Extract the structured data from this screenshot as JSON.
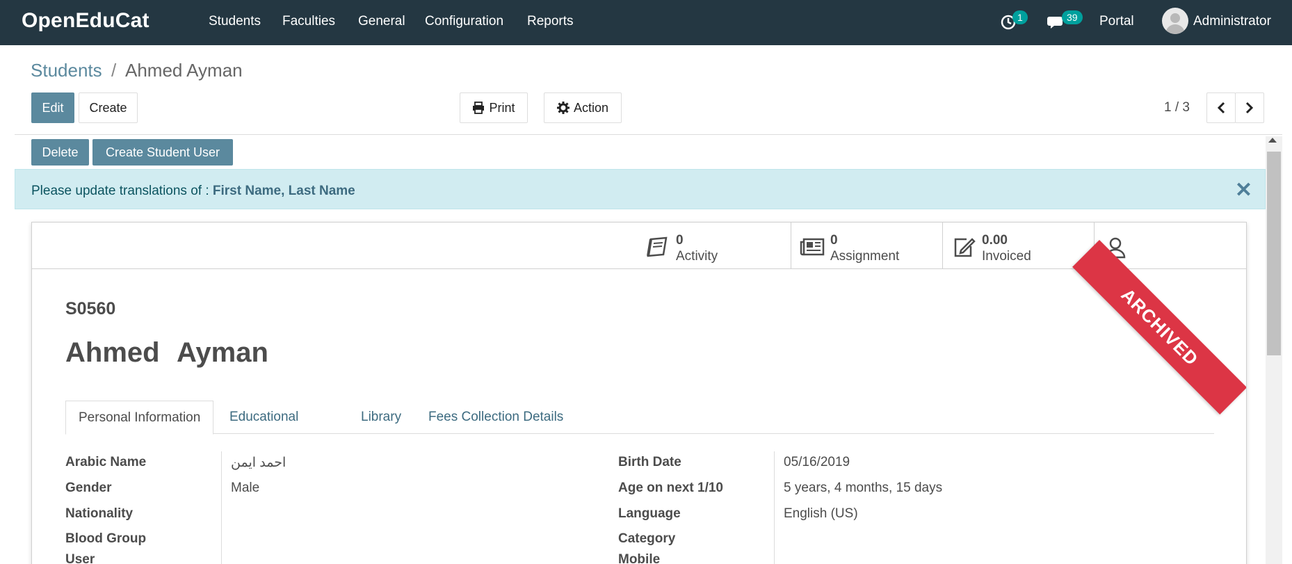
{
  "navbar": {
    "brand": "OpenEduCat",
    "menu": [
      "Students",
      "Faculties",
      "General",
      "Configuration",
      "Reports"
    ],
    "activity_count": "1",
    "messages_count": "39",
    "portal_label": "Portal",
    "user_name": "Administrator"
  },
  "breadcrumb": {
    "parent": "Students",
    "separator": "/",
    "current": "Ahmed Ayman"
  },
  "toolbar": {
    "edit_label": "Edit",
    "create_label": "Create",
    "print_label": "Print",
    "action_label": "Action",
    "pager_value": "1 / 3"
  },
  "actions": {
    "delete_label": "Delete",
    "create_user_label": "Create Student User"
  },
  "alert": {
    "text": "Please update translations of : ",
    "fields": "First Name, Last Name",
    "close_glyph": "✕"
  },
  "stats": [
    {
      "value": "0",
      "label": "Activity",
      "icon": "book-icon"
    },
    {
      "value": "0",
      "label": "Assignment",
      "icon": "newspaper-icon"
    },
    {
      "value": "0.00",
      "label": "Invoiced",
      "icon": "edit-icon"
    },
    {
      "value": "",
      "label": "",
      "icon": "user-icon"
    }
  ],
  "ribbon": "ARCHIVED",
  "record": {
    "code": "S0560",
    "first_name": "Ahmed",
    "last_name": "Ayman"
  },
  "tabs": [
    "Personal Information",
    "Educational",
    "Library",
    "Fees Collection Details"
  ],
  "fields_left": [
    {
      "label": "Arabic Name",
      "value": "احمد ايمن"
    },
    {
      "label": "Gender",
      "value": "Male"
    },
    {
      "label": "Nationality",
      "value": ""
    },
    {
      "label": "Blood Group",
      "value": ""
    },
    {
      "label": "User",
      "value": ""
    }
  ],
  "fields_right": [
    {
      "label": "Birth Date",
      "value": "05/16/2019"
    },
    {
      "label": "Age on next 1/10",
      "value": "5 years, 4 months, 15 days"
    },
    {
      "label": "Language",
      "value": "English (US)"
    },
    {
      "label": "Category",
      "value": ""
    },
    {
      "label": "Mobile",
      "value": ""
    }
  ],
  "colors": {
    "navbar_bg": "#243742",
    "primary": "#5b899e",
    "badge": "#00a09d",
    "alert_bg": "#d1ecf1",
    "ribbon": "#dc3545"
  }
}
